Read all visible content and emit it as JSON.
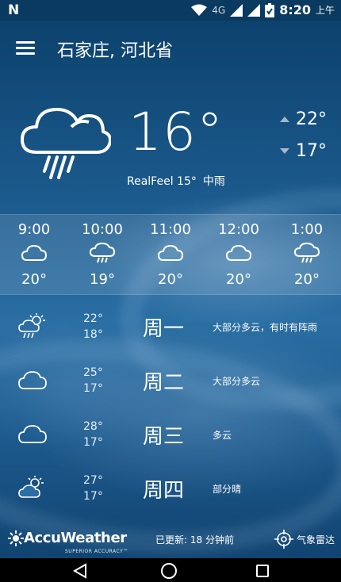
{
  "status_bar": {
    "network": "4G",
    "time": "8:20",
    "ampm": "上午"
  },
  "header": {
    "location": "石家庄, 河北省"
  },
  "current": {
    "temp": "16°",
    "high": "22°",
    "low": "17°",
    "realfeel": "RealFeel 15°",
    "condition": "中雨"
  },
  "hourly": [
    {
      "time": "9:00",
      "temp": "20°",
      "icon": "cloud-icon"
    },
    {
      "time": "10:00",
      "temp": "19°",
      "icon": "cloud-rain-icon"
    },
    {
      "time": "11:00",
      "temp": "20°",
      "icon": "cloud-icon"
    },
    {
      "time": "12:00",
      "temp": "20°",
      "icon": "cloud-icon"
    },
    {
      "time": "1:00",
      "temp": "20°",
      "icon": "cloud-rain-icon"
    }
  ],
  "daily": [
    {
      "name": "周一",
      "high": "22°",
      "low": "18°",
      "desc": "大部分多云，有时有阵雨",
      "icon": "sun-cloud-rain-icon"
    },
    {
      "name": "周二",
      "high": "25°",
      "low": "17°",
      "desc": "大部分多云",
      "icon": "cloud-icon"
    },
    {
      "name": "周三",
      "high": "28°",
      "low": "17°",
      "desc": "多云",
      "icon": "cloud-icon"
    },
    {
      "name": "周四",
      "high": "27°",
      "low": "17°",
      "desc": "部分晴",
      "icon": "sun-cloud-icon"
    }
  ],
  "footer": {
    "brand": "AccuWeather",
    "tagline": "SUPERIOR ACCURACY™",
    "updated": "已更新:  18 分钟前",
    "radar_label": "气象雷达"
  }
}
